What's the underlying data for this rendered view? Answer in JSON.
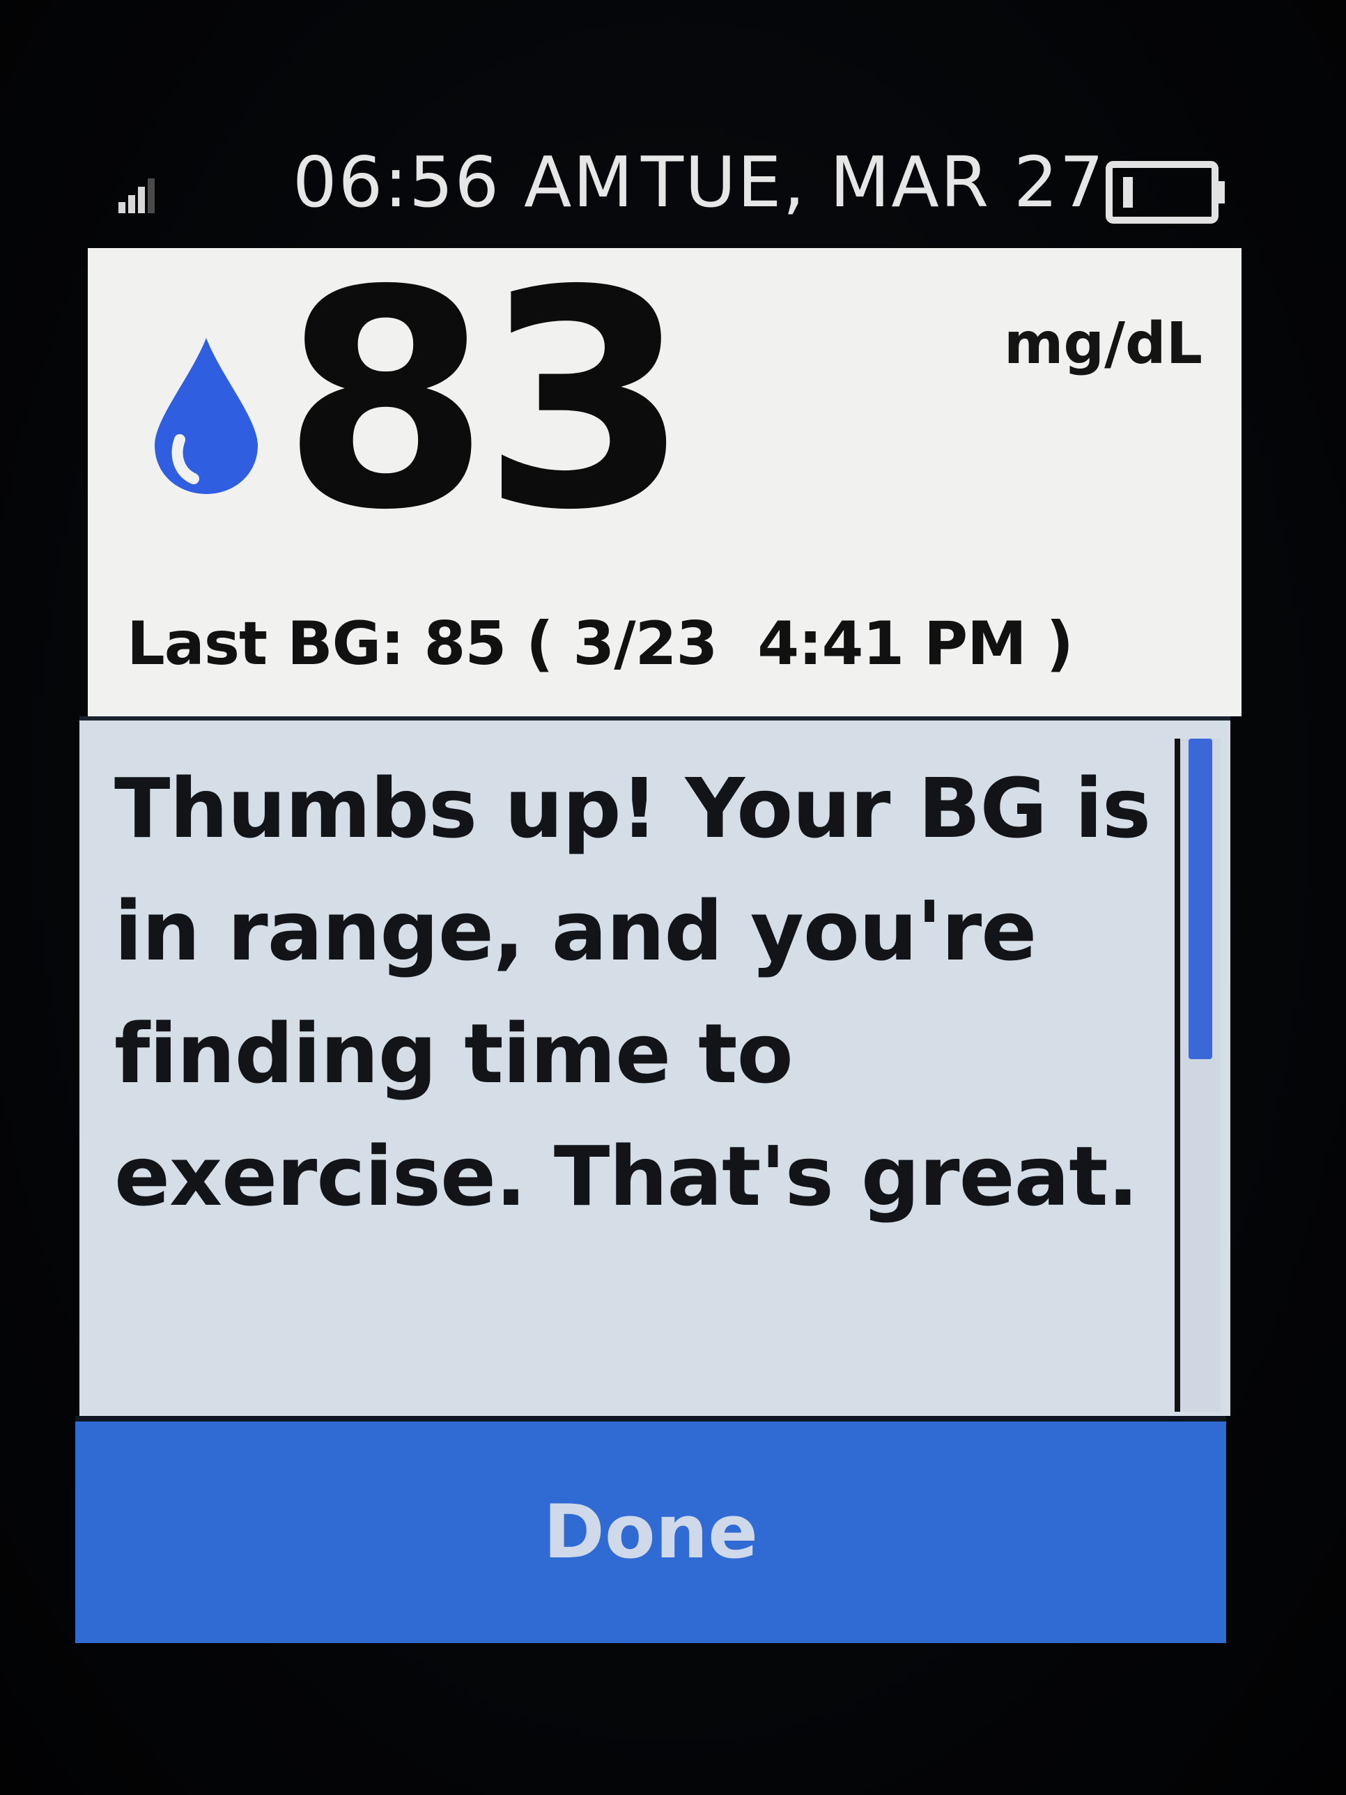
{
  "status_bar": {
    "time": "06:56 AM",
    "date": "TUE, MAR 27",
    "signal_icon": "signal-icon",
    "battery_icon": "battery-icon"
  },
  "reading": {
    "value": "83",
    "unit": "mg/dL",
    "icon": "blood-drop-icon",
    "icon_color": "#2f5fe0",
    "last_bg": "Last BG: 85 ( 3/23  4:41 PM )"
  },
  "message": {
    "text": "Thumbs up! Your BG is in range, and you're finding time to exercise. That's great."
  },
  "actions": {
    "done_label": "Done",
    "done_color": "#2f6bd3"
  }
}
